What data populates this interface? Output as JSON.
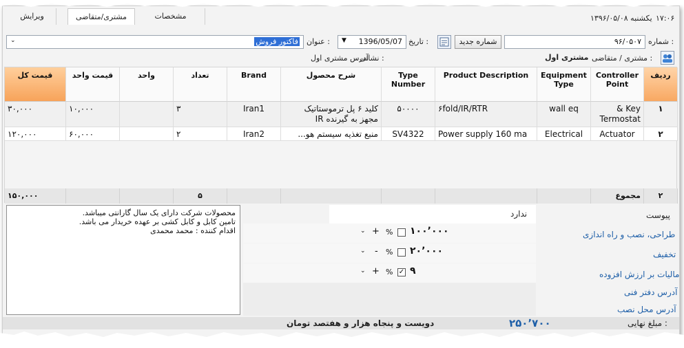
{
  "tabs": {
    "edit": "ویرایش",
    "customer": "مشتری/متقاضی",
    "specs": "مشخصات"
  },
  "status": {
    "time": "۱۷:۰۶",
    "date_text": "یکشنبه ۱۳۹۶/۰۵/۰۸"
  },
  "header": {
    "number_label": "شماره :",
    "number_value": "۹۶/۰۵۰۷",
    "new_number_button": "شماره جدید",
    "date_label": "تاریخ :",
    "date_value": "1396/05/07",
    "title_label": "عنوان :",
    "title_value": "فاکتور فروش",
    "customer_label": "مشتری / متقاضی :",
    "customer_value": "مشتری اول",
    "address_label": "نشانی :",
    "address_value": "آدرس مشتری اول"
  },
  "table": {
    "headers": {
      "row": "ردیف",
      "controller": "Controller Point",
      "equipment": "Equipment Type",
      "product_desc": "Product Description",
      "type_number": "Type Number",
      "product_desc_fa": "شرح محصول",
      "brand": "Brand",
      "qty": "تعداد",
      "unit": "واحد",
      "unit_price": "قیمت واحد",
      "total": "قیمت کل"
    },
    "rows": [
      {
        "row": "۱",
        "controller": "& Key Termostat",
        "equipment": "wall eq",
        "product_desc": "۶fold/IR/RTR",
        "type_number": "۵۰۰۰۰",
        "product_desc_fa": "کلید ۶ پل ترموستاتیک مجهز به گیرنده IR",
        "brand": "Iran1",
        "qty": "۳",
        "unit": "",
        "unit_price": "۱۰,۰۰۰",
        "total": "۳۰,۰۰۰"
      },
      {
        "row": "۲",
        "controller": "Actuator",
        "equipment": "Electrical",
        "product_desc": "Power supply 160 ma",
        "type_number": "SV4322",
        "product_desc_fa": "منبع تغذیه سیستم هو...",
        "brand": "Iran2",
        "qty": "۲",
        "unit": "",
        "unit_price": "۶۰,۰۰۰",
        "total": "۱۲۰,۰۰۰"
      }
    ],
    "footer": {
      "count": "۲",
      "sum_label": "مجموع",
      "qty_total": "۵",
      "grand_total": "۱۵۰,۰۰۰"
    }
  },
  "notes": {
    "line1": "محصولات شرکت دارای یک سال گارانتی میباشد.",
    "line2": "تامین کابل و کابل کشی بر عهده خریدار می باشد.",
    "line3": "اقدام کننده : محمد محمدی"
  },
  "summary": {
    "attachment_label": "پیوست",
    "attachment_value": "ندارد",
    "design_label": "طراحی، نصب و راه اندازی",
    "design_value": "۱۰۰٬۰۰۰",
    "design_sign": "+",
    "discount_label": "تخفیف",
    "discount_value": "۲۰٬۰۰۰",
    "discount_sign": "-",
    "vat_label": "مالیات بر ارزش افزوده",
    "vat_value": "۹",
    "vat_sign": "+",
    "vat_checked": true,
    "percent_symbol": "%",
    "office_address_label": "آدرس دفتر فنی",
    "install_address_label": "آدرس محل نصب",
    "final_label": "مبلغ نهایی :",
    "final_value": "۲۵۰٬۷۰۰",
    "final_words": "دویست و پنجاه  هزار و هفتصد تومان"
  },
  "colors": {
    "header_orange": "#f7a35a",
    "link_blue": "#1e5fa8",
    "selection_blue": "#2f6fd6"
  }
}
